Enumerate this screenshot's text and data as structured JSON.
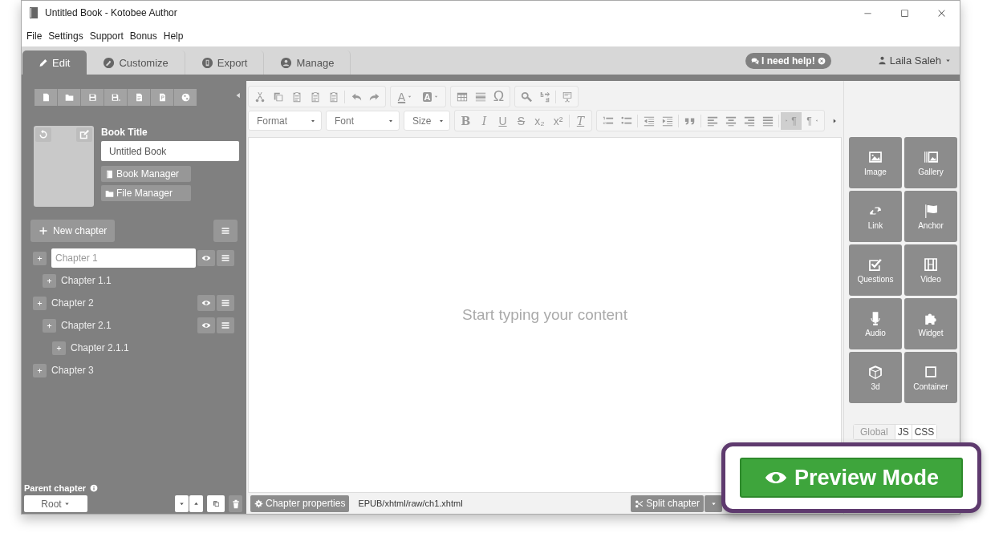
{
  "window": {
    "title": "Untitled Book - Kotobee Author"
  },
  "menu": [
    "File",
    "Settings",
    "Support",
    "Bonus",
    "Help"
  ],
  "tabs": [
    {
      "label": "Edit",
      "selected": true
    },
    {
      "label": "Customize",
      "selected": false
    },
    {
      "label": "Export",
      "selected": false
    },
    {
      "label": "Manage",
      "selected": false
    }
  ],
  "help_button": {
    "label": "I need help!"
  },
  "user_menu": {
    "label": "Laila Saleh"
  },
  "book": {
    "title_label": "Book Title",
    "title_value": "Untitled Book",
    "buttons": [
      "Book Manager",
      "File Manager"
    ]
  },
  "new_chapter_button": {
    "label": "New chapter"
  },
  "chapters": [
    {
      "title": "Chapter 1",
      "editing": true,
      "actions_visible": true,
      "children": [
        {
          "title": "Chapter 1.1",
          "editing": false,
          "actions_visible": false
        }
      ]
    },
    {
      "title": "Chapter 2",
      "editing": false,
      "actions_visible": true,
      "children": [
        {
          "title": "Chapter 2.1",
          "editing": false,
          "actions_visible": true,
          "children": [
            {
              "title": "Chapter 2.1.1",
              "editing": false,
              "actions_visible": false
            }
          ]
        }
      ]
    },
    {
      "title": "Chapter 3",
      "editing": false,
      "actions_visible": false
    }
  ],
  "parent_chapter": {
    "label": "Parent chapter",
    "value": "Root"
  },
  "editor": {
    "color_buttons": [
      "A",
      "A"
    ],
    "special_char": "Ω",
    "dropdowns": [
      "Format",
      "Font",
      "Size"
    ],
    "format_buttons": [
      "B",
      "I",
      "U",
      "S",
      "x₂",
      "x²"
    ],
    "clear_format": "T",
    "direction": [
      {
        "label": "¶",
        "kind": "ltr",
        "selected": true
      },
      {
        "label": "¶",
        "kind": "rtl",
        "selected": false
      }
    ],
    "empty_message": "Start typing your content"
  },
  "status": {
    "properties_button": "Chapter properties",
    "path": "EPUB/xhtml/raw/ch1.xhtml",
    "split_button": "Split chapter"
  },
  "widgets": [
    "Image",
    "Gallery",
    "Link",
    "Anchor",
    "Questions",
    "Video",
    "Audio",
    "Widget",
    "3d",
    "Container"
  ],
  "code_tabs": [
    {
      "label": "Global",
      "selected": true
    },
    {
      "label": "JS",
      "selected": false
    },
    {
      "label": "CSS",
      "selected": false
    }
  ],
  "preview_button": {
    "label": "Preview Mode"
  }
}
